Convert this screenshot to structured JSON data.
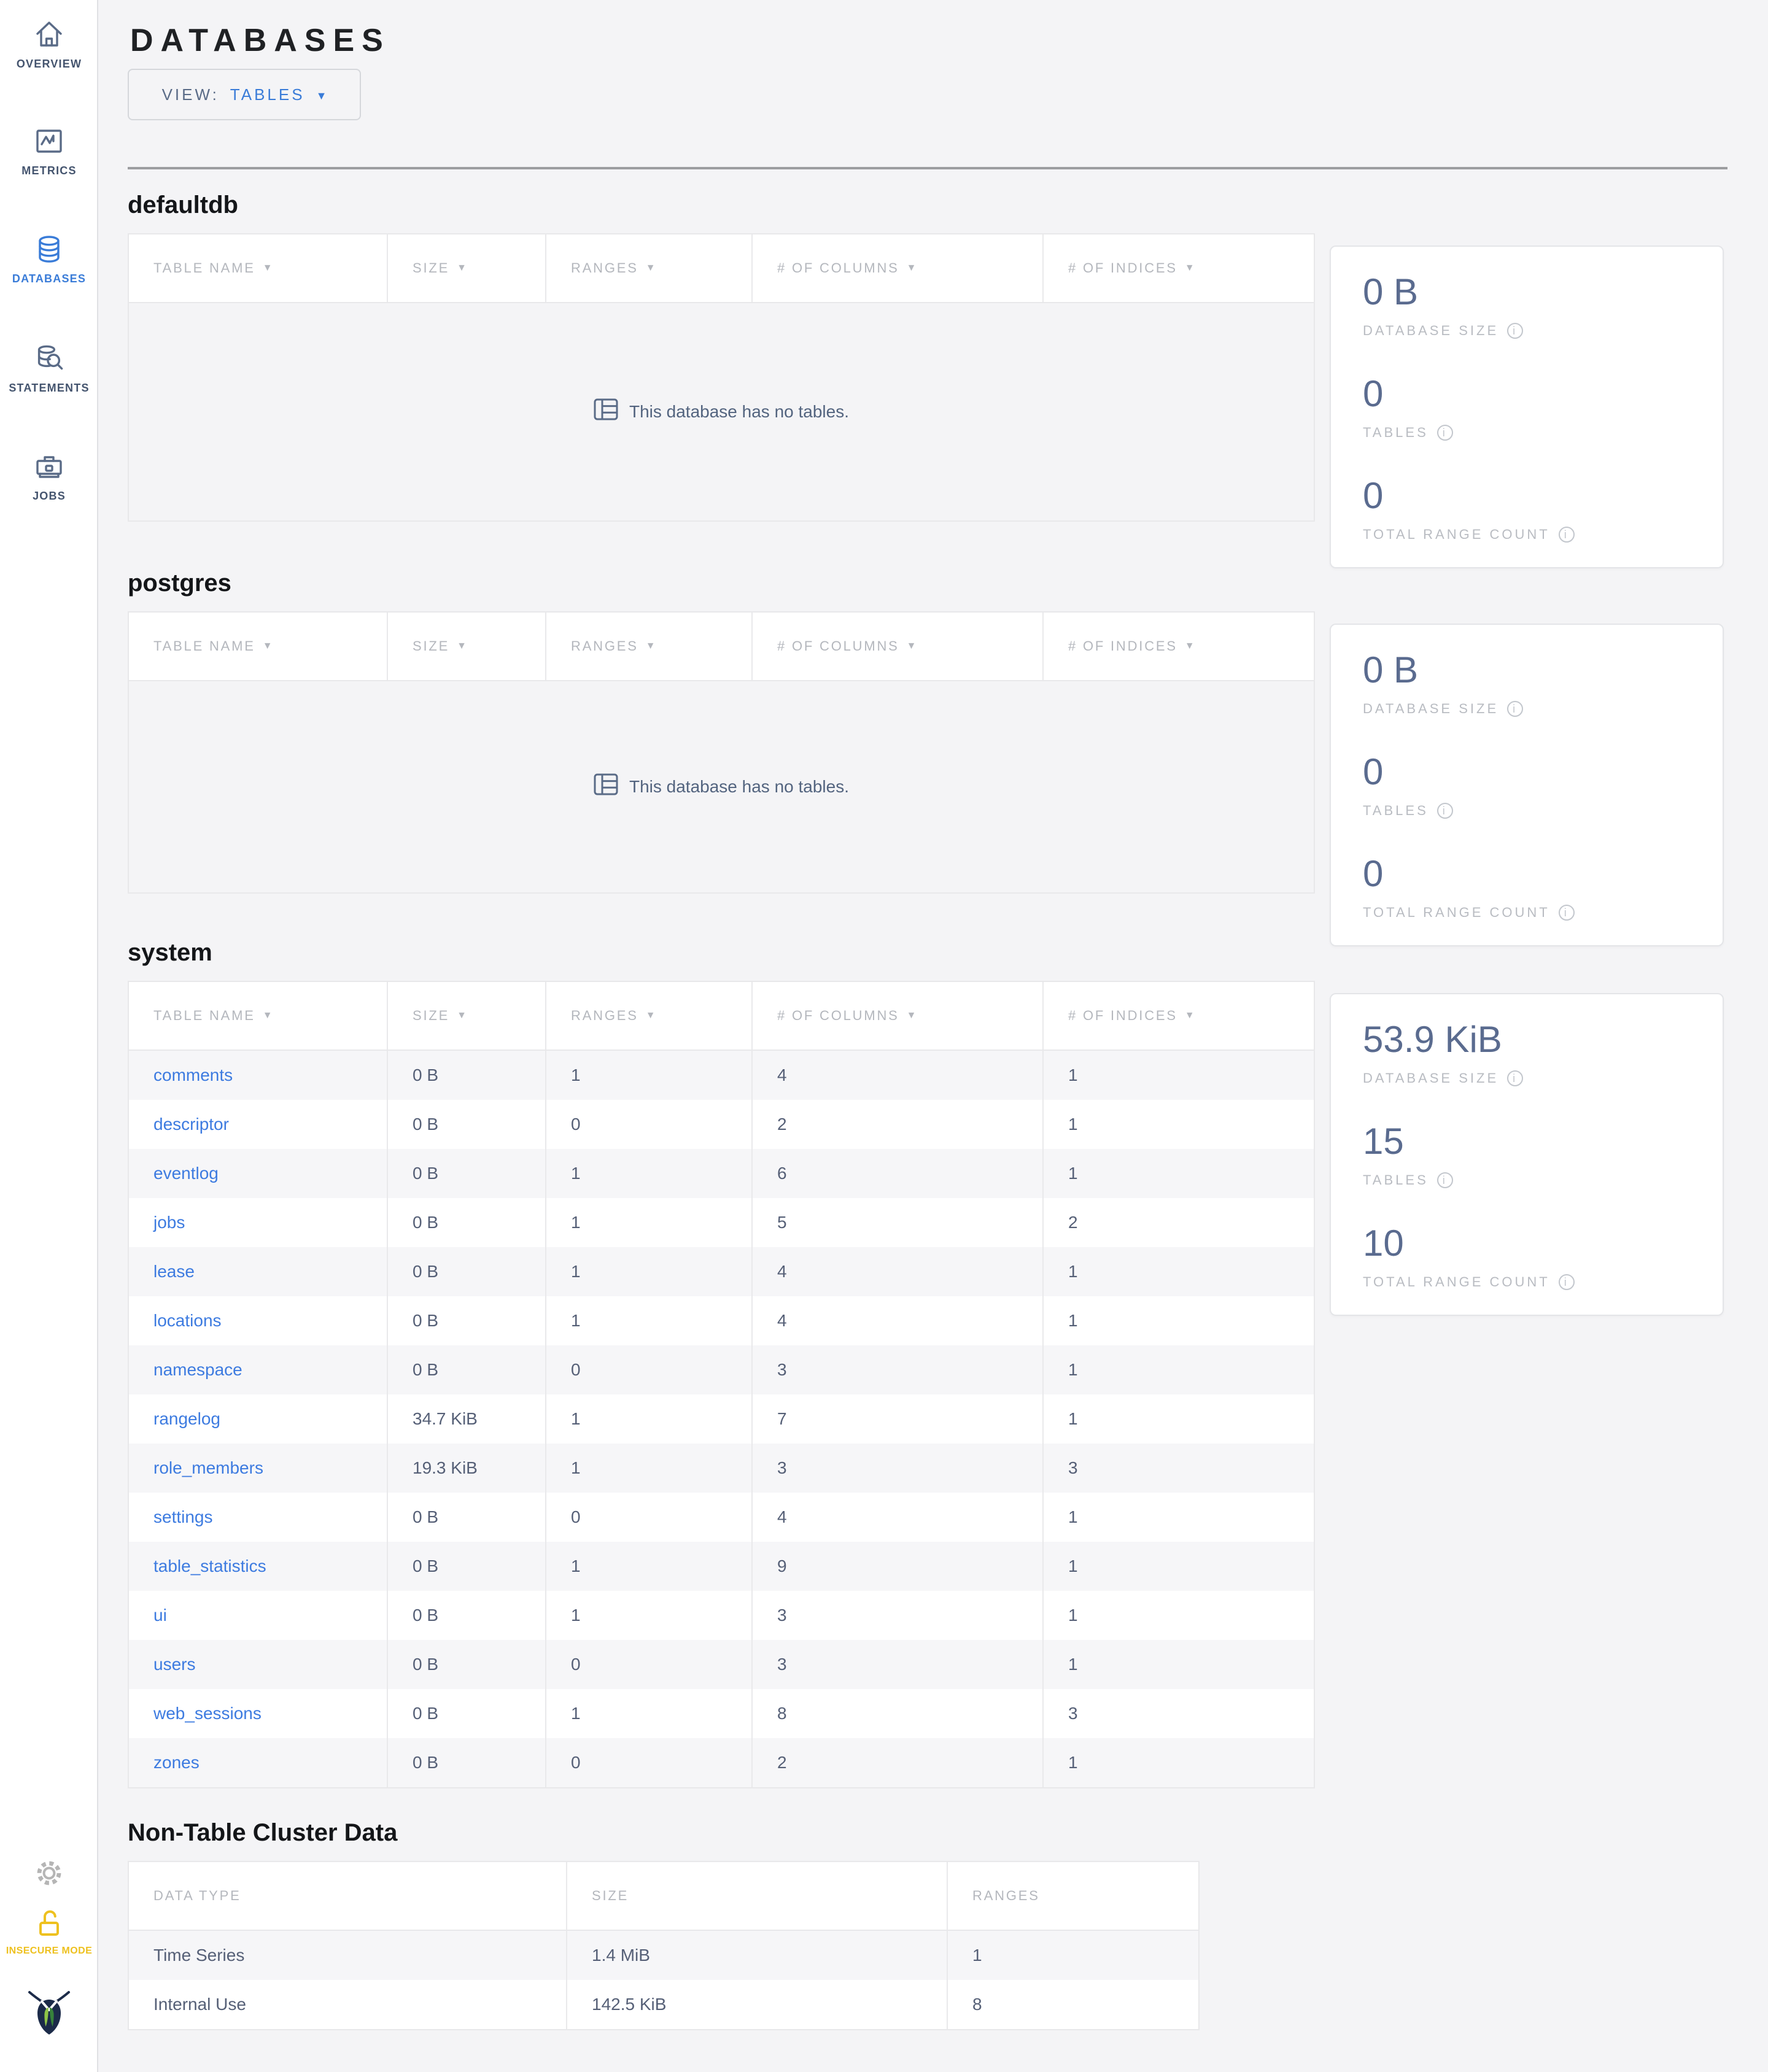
{
  "page_title": "DATABASES",
  "view_control": {
    "label": "VIEW:",
    "value": "TABLES"
  },
  "sidebar": {
    "items": [
      {
        "label": "OVERVIEW"
      },
      {
        "label": "METRICS"
      },
      {
        "label": "DATABASES",
        "active": true
      },
      {
        "label": "STATEMENTS"
      },
      {
        "label": "JOBS"
      }
    ],
    "insecure_label": "INSECURE MODE"
  },
  "table_headers": {
    "name": "TABLE NAME",
    "size": "SIZE",
    "ranges": "RANGES",
    "columns": "# OF COLUMNS",
    "indices": "# OF INDICES"
  },
  "empty_message": "This database has no tables.",
  "stat_labels": {
    "size": "DATABASE SIZE",
    "tables": "TABLES",
    "ranges": "TOTAL RANGE COUNT"
  },
  "colors": {
    "accent_blue": "#3a7cd8",
    "link_blue": "#3d7be0",
    "slate": "#5a6b87",
    "insecure_yellow": "#eec11f",
    "logo_navy": "#1c2b49",
    "logo_green_light": "#8fc447",
    "logo_green_dark": "#37833b"
  },
  "databases": [
    {
      "name": "defaultdb",
      "stats": {
        "size": "0 B",
        "tables": "0",
        "ranges": "0"
      }
    },
    {
      "name": "postgres",
      "stats": {
        "size": "0 B",
        "tables": "0",
        "ranges": "0"
      }
    },
    {
      "name": "system",
      "stats": {
        "size": "53.9 KiB",
        "tables": "15",
        "ranges": "10"
      },
      "tables": [
        [
          "comments",
          "0 B",
          "1",
          "4",
          "1"
        ],
        [
          "descriptor",
          "0 B",
          "0",
          "2",
          "1"
        ],
        [
          "eventlog",
          "0 B",
          "1",
          "6",
          "1"
        ],
        [
          "jobs",
          "0 B",
          "1",
          "5",
          "2"
        ],
        [
          "lease",
          "0 B",
          "1",
          "4",
          "1"
        ],
        [
          "locations",
          "0 B",
          "1",
          "4",
          "1"
        ],
        [
          "namespace",
          "0 B",
          "0",
          "3",
          "1"
        ],
        [
          "rangelog",
          "34.7 KiB",
          "1",
          "7",
          "1"
        ],
        [
          "role_members",
          "19.3 KiB",
          "1",
          "3",
          "3"
        ],
        [
          "settings",
          "0 B",
          "0",
          "4",
          "1"
        ],
        [
          "table_statistics",
          "0 B",
          "1",
          "9",
          "1"
        ],
        [
          "ui",
          "0 B",
          "1",
          "3",
          "1"
        ],
        [
          "users",
          "0 B",
          "0",
          "3",
          "1"
        ],
        [
          "web_sessions",
          "0 B",
          "1",
          "8",
          "3"
        ],
        [
          "zones",
          "0 B",
          "0",
          "2",
          "1"
        ]
      ]
    }
  ],
  "non_table": {
    "heading": "Non-Table Cluster Data",
    "headers": [
      "DATA TYPE",
      "SIZE",
      "RANGES"
    ],
    "rows": [
      [
        "Time Series",
        "1.4 MiB",
        "1"
      ],
      [
        "Internal Use",
        "142.5 KiB",
        "8"
      ]
    ]
  }
}
